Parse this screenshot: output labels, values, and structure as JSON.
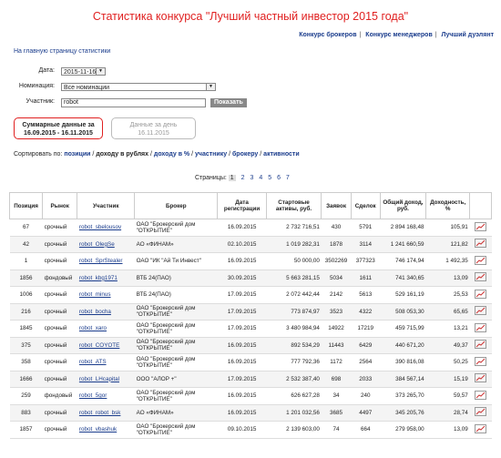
{
  "title": "Статистика конкурса \"Лучший частный инвестор 2015 года\"",
  "topnav": [
    "Конкурс брокеров",
    "Конкурс менеджеров",
    "Лучший дуэлянт"
  ],
  "home_link": "На главную страницу статистики",
  "filters": {
    "date_label": "Дата:",
    "date_value": "2015-11-16",
    "nomination_label": "Номинация:",
    "nomination_value": "Все номинации",
    "participant_label": "Участник:",
    "participant_value": "robot",
    "show_button": "Показать"
  },
  "summary_box": {
    "line1": "Суммарные данные за",
    "line2": "16.09.2015 - 16.11.2015"
  },
  "day_box": {
    "line1": "Данные за день",
    "line2": "16.11.2015"
  },
  "sort": {
    "label": "Сортировать по:",
    "items": [
      "позиции",
      "доходу в рублях",
      "доходу в %",
      "участнику",
      "брокеру",
      "активности"
    ]
  },
  "pager": {
    "label": "Страницы:",
    "pages": [
      "1",
      "2",
      "3",
      "4",
      "5",
      "6",
      "7"
    ],
    "current": "1"
  },
  "table": {
    "headers": [
      "Позиция",
      "Рынок",
      "Участник",
      "Брокер",
      "Дата регистрации",
      "Стартовые активы, руб.",
      "Заявок",
      "Сделок",
      "Общий доход, руб.",
      "Доходность, %",
      ""
    ],
    "rows": [
      [
        "67",
        "срочный",
        "robot_sbelousov",
        "ОАО \"Брокерский дом \"ОТКРЫТИЕ\"",
        "16.09.2015",
        "2 732 716,51",
        "430",
        "5791",
        "2 894 168,48",
        "105,91"
      ],
      [
        "42",
        "срочный",
        "robot_OlegSe",
        "АО «ФИНАМ»",
        "02.10.2015",
        "1 019 282,31",
        "1878",
        "3114",
        "1 241 660,59",
        "121,82"
      ],
      [
        "1",
        "срочный",
        "robot_SprStealer",
        "ОАО \"ИК \"Ай Ти Инвест\"",
        "16.09.2015",
        "50 000,00",
        "3502269",
        "377323",
        "746 174,94",
        "1 492,35"
      ],
      [
        "1856",
        "фондовый",
        "robot_kbg1971",
        "ВТБ 24(ПАО)",
        "30.09.2015",
        "5 663 281,15",
        "5034",
        "1611",
        "741 340,65",
        "13,09"
      ],
      [
        "1006",
        "срочный",
        "robot_minus",
        "ВТБ 24(ПАО)",
        "17.09.2015",
        "2 072 442,44",
        "2142",
        "5613",
        "529 161,19",
        "25,53"
      ],
      [
        "216",
        "срочный",
        "robot_bocha",
        "ОАО \"Брокерский дом \"ОТКРЫТИЕ\"",
        "17.09.2015",
        "773 874,97",
        "3523",
        "4322",
        "508 053,30",
        "65,65"
      ],
      [
        "1845",
        "срочный",
        "robot_xaro",
        "ОАО \"Брокерский дом \"ОТКРЫТИЕ\"",
        "17.09.2015",
        "3 480 984,94",
        "14922",
        "17219",
        "459 715,99",
        "13,21"
      ],
      [
        "375",
        "срочный",
        "robot_COYOTE",
        "ОАО \"Брокерский дом \"ОТКРЫТИЕ\"",
        "16.09.2015",
        "892 534,29",
        "11443",
        "6429",
        "440 671,20",
        "49,37"
      ],
      [
        "358",
        "срочный",
        "robot_ATS",
        "ОАО \"Брокерский дом \"ОТКРЫТИЕ\"",
        "16.09.2015",
        "777 792,36",
        "1172",
        "2564",
        "390 816,08",
        "50,25"
      ],
      [
        "1666",
        "срочный",
        "robot_LHcapital",
        "ООО \"АЛОР +\"",
        "17.09.2015",
        "2 532 387,40",
        "698",
        "2033",
        "384 567,14",
        "15,19"
      ],
      [
        "259",
        "фондовый",
        "robot_5gor",
        "ОАО \"Брокерский дом \"ОТКРЫТИЕ\"",
        "16.09.2015",
        "626 627,28",
        "34",
        "240",
        "373 265,70",
        "59,57"
      ],
      [
        "883",
        "срочный",
        "robot_robot_bsk",
        "АО «ФИНАМ»",
        "16.09.2015",
        "1 201 032,56",
        "3685",
        "4497",
        "345 205,76",
        "28,74"
      ],
      [
        "1857",
        "срочный",
        "robot_vbashuk",
        "ОАО \"Брокерский дом \"ОТКРЫТИЕ\"",
        "09.10.2015",
        "2 139 603,00",
        "74",
        "664",
        "279 958,00",
        "13,09"
      ]
    ]
  }
}
